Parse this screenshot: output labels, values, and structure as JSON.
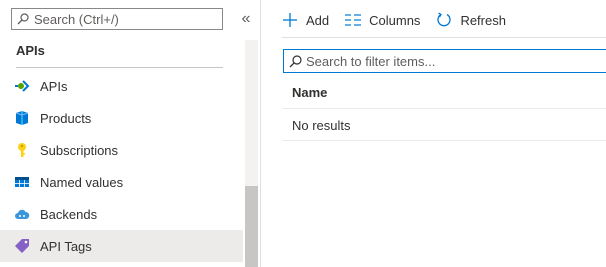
{
  "sidebar": {
    "search_placeholder": "Search (Ctrl+/)",
    "collapse_glyph": "«",
    "section_title": "APIs",
    "items": [
      {
        "label": "APIs",
        "icon": "api-icon",
        "selected": false
      },
      {
        "label": "Products",
        "icon": "products-icon",
        "selected": false
      },
      {
        "label": "Subscriptions",
        "icon": "key-icon",
        "selected": false
      },
      {
        "label": "Named values",
        "icon": "table-icon",
        "selected": false
      },
      {
        "label": "Backends",
        "icon": "cloud-icon",
        "selected": false
      },
      {
        "label": "API Tags",
        "icon": "tag-icon",
        "selected": true
      }
    ]
  },
  "toolbar": {
    "add_label": "Add",
    "columns_label": "Columns",
    "refresh_label": "Refresh"
  },
  "filter": {
    "placeholder": "Search to filter items...",
    "value": ""
  },
  "table": {
    "columns": [
      "Name"
    ],
    "empty_text": "No results"
  },
  "colors": {
    "accent": "#0078d4",
    "selected_bg": "#edebe9"
  }
}
